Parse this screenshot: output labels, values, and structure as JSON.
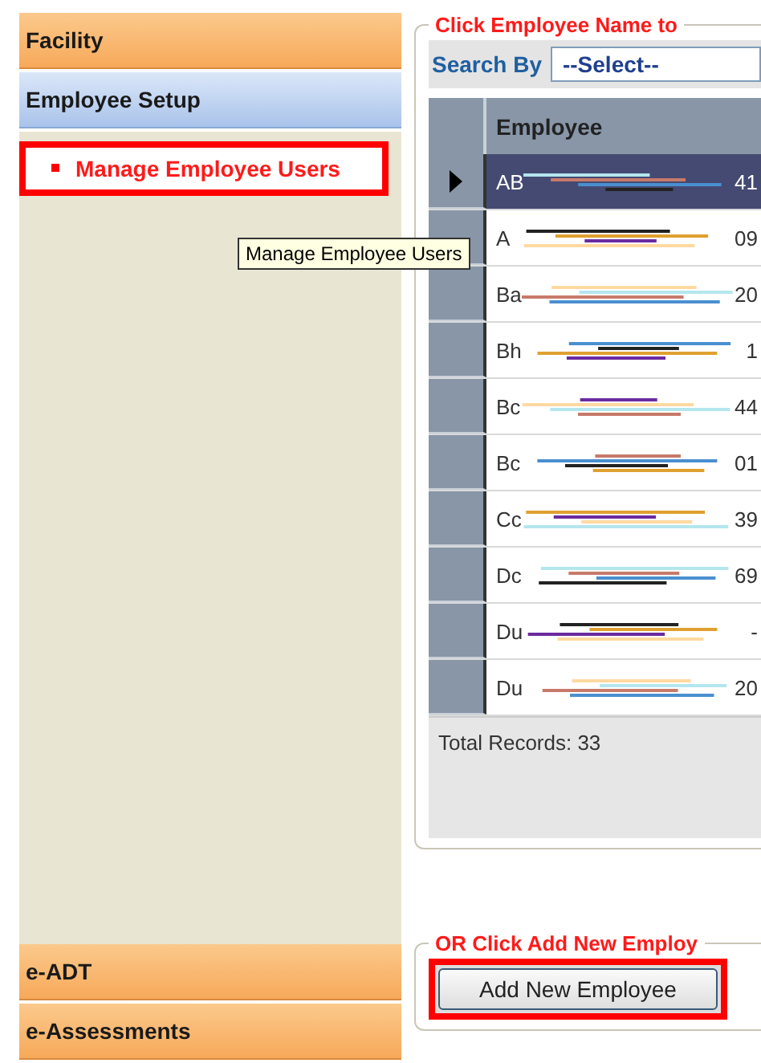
{
  "sidebar": {
    "sections": [
      {
        "label": "Facility",
        "kind": "orange"
      },
      {
        "label": "Employee Setup",
        "kind": "blue"
      }
    ],
    "items": [
      {
        "label": "Manage Employee Users",
        "selected": true
      }
    ],
    "bottom_sections": [
      {
        "label": "e-ADT"
      },
      {
        "label": "e-Assessments"
      }
    ]
  },
  "tooltip": "Manage Employee Users",
  "employee_panel": {
    "legend": "Click Employee Name to",
    "search_label": "Search By",
    "search_select": "--Select--",
    "columns": [
      "Employee"
    ],
    "rows": [
      {
        "name": "AB",
        "trailing": "41",
        "selected": true
      },
      {
        "name": "A",
        "trailing": "09",
        "selected": false
      },
      {
        "name": "Ba",
        "trailing": "20",
        "selected": false
      },
      {
        "name": "Bh",
        "trailing": "1",
        "selected": false
      },
      {
        "name": "Bc",
        "trailing": "44",
        "selected": false
      },
      {
        "name": "Bc",
        "trailing": "01",
        "selected": false
      },
      {
        "name": "Cc",
        "trailing": "39",
        "selected": false
      },
      {
        "name": "Dc",
        "trailing": "69",
        "selected": false
      },
      {
        "name": "Du",
        "trailing": "-",
        "selected": false
      },
      {
        "name": "Du",
        "trailing": "20",
        "selected": false
      }
    ],
    "total": "Total Records: 33"
  },
  "add_panel": {
    "legend": "OR Click Add New Employ",
    "button": "Add New Employee"
  }
}
